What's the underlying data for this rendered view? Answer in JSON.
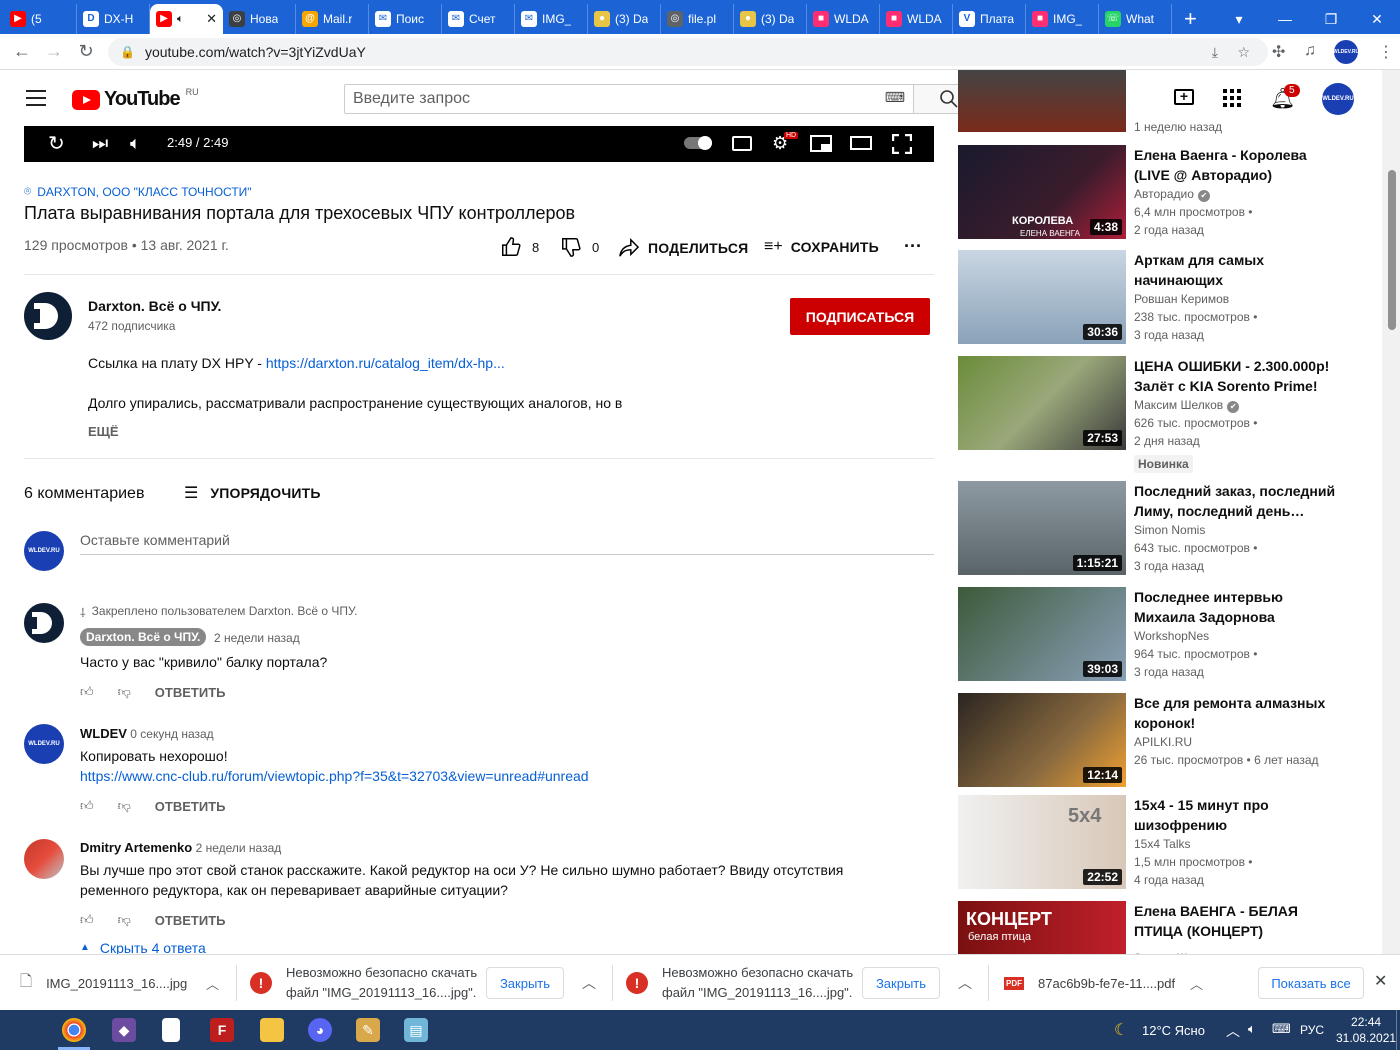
{
  "browser": {
    "tabs": [
      {
        "label": "(5",
        "color": "#ff0000",
        "letter": "▶"
      },
      {
        "label": "DX-H",
        "color": "#ffffff",
        "letter": "D"
      },
      {
        "label": "",
        "color": "#ff0000",
        "letter": "▶",
        "active": true
      },
      {
        "label": "Нова",
        "color": "#3c4043",
        "letter": "◎"
      },
      {
        "label": "Mail.r",
        "color": "#f7a600",
        "letter": "@"
      },
      {
        "label": "Поис",
        "color": "#ffffff",
        "letter": "✉"
      },
      {
        "label": "Счет",
        "color": "#ffffff",
        "letter": "✉"
      },
      {
        "label": "IMG_",
        "color": "#ffffff",
        "letter": "✉"
      },
      {
        "label": "(3) Da",
        "color": "#e8c547",
        "letter": "●"
      },
      {
        "label": "file.pl",
        "color": "#5f6368",
        "letter": "◎"
      },
      {
        "label": "(3) Da",
        "color": "#e8c547",
        "letter": "●"
      },
      {
        "label": "WLDA",
        "color": "#ff2d72",
        "letter": "■"
      },
      {
        "label": "WLDA",
        "color": "#ff2d72",
        "letter": "■"
      },
      {
        "label": "Плата",
        "color": "#ffffff",
        "letter": "V"
      },
      {
        "label": "IMG_",
        "color": "#ff2d72",
        "letter": "■"
      },
      {
        "label": "What",
        "color": "#25d366",
        "letter": "☏"
      }
    ],
    "url": "youtube.com/watch?v=3jtYiZvdUaY"
  },
  "header": {
    "logo_word": "YouTube",
    "logo_region": "RU",
    "search_placeholder": "Введите запрос",
    "notifications": "5",
    "user_avatar": "WLDEV.RU"
  },
  "player": {
    "time": "2:49 / 2:49"
  },
  "video": {
    "hashtag": "DARXTON, ООО \"КЛАСС ТОЧНОСТИ\"",
    "title": "Плата выравнивания портала для трехосевых ЧПУ контроллеров",
    "stats": "129 просмотров • 13 авг. 2021 г.",
    "likes": "8",
    "dislikes": "0",
    "share": "ПОДЕЛИТЬСЯ",
    "save": "СОХРАНИТЬ"
  },
  "channel": {
    "name": "Darxton. Всё о ЧПУ.",
    "subs": "472 подписчика",
    "subscribe": "ПОДПИСАТЬСЯ",
    "desc_prefix": "Ссылка на плату DX HPY - ",
    "desc_link": "https://darxton.ru/catalog_item/dx-hp...",
    "desc_line2": "Долго упирались, рассматривали распространение существующих аналогов, но в",
    "more": "ЕЩЁ"
  },
  "comments": {
    "count": "6 комментариев",
    "sort": "УПОРЯДОЧИТЬ",
    "placeholder": "Оставьте комментарий",
    "my_avatar": "WLDEV.RU",
    "reply": "ОТВЕТИТЬ",
    "items": [
      {
        "pinned": "Закреплено пользователем Darxton. Всё о ЧПУ.",
        "author": "Darxton. Всё о ЧПУ.",
        "time": "2 недели назад",
        "text": "Часто у вас \"кривило\" балку портала?"
      },
      {
        "author": "WLDEV",
        "time": "0 секунд назад",
        "text": "Копировать нехорошо!",
        "link": "https://www.cnc-club.ru/forum/viewtopic.php?f=35&t=32703&view=unread#unread"
      },
      {
        "author": "Dmitry Artemenko",
        "time": "2 недели назад",
        "text1": "Вы лучше про этот свой станок расскажите. Какой редуктор на оси У? Не сильно шумно работает? Ввиду отсутствия",
        "text2": "ременного редуктора, как он переваривает аварийные ситуации?",
        "replies": "Скрыть 4 ответа"
      }
    ]
  },
  "sidebar": {
    "top_partial": "1 неделю назад",
    "videos": [
      {
        "title1": "Елена Ваенга - Королева",
        "title2": "(LIVE @ Авторадио)",
        "channel": "Авторадио",
        "views": "6,4 млн просмотров •",
        "age": "2 года назад",
        "duration": "4:38",
        "thumb_text": "КОРОЛЕВА",
        "thumb_sub": "ЕЛЕНА ВАЕНГА"
      },
      {
        "title1": "Арткам для самых",
        "title2": "начинающих",
        "channel": "Ровшан Керимов",
        "views": "238 тыс. просмотров •",
        "age": "3 года назад",
        "duration": "30:36"
      },
      {
        "title1": "ЦЕНА ОШИБКИ - 2.300.000р!",
        "title2": "Залёт с KIA Sorento Prime!",
        "channel": "Максим Шелков",
        "views": "626 тыс. просмотров •",
        "age": "2 дня назад",
        "duration": "27:53",
        "badge": "Новинка"
      },
      {
        "title1": "Последний заказ, последний",
        "title2": "Лиму, последний день…",
        "channel": "Simon Nomis",
        "views": "643 тыс. просмотров •",
        "age": "3 года назад",
        "duration": "1:15:21"
      },
      {
        "title1": "Последнее интервью",
        "title2": "Михаила Задорнова",
        "channel": "WorkshopNes",
        "views": "964 тыс. просмотров •",
        "age": "3 года назад",
        "duration": "39:03"
      },
      {
        "title1": "Все для ремонта алмазных",
        "title2": "коронок!",
        "channel": "APILKI.RU",
        "views": "26 тыс. просмотров • 6 лет назад",
        "age": "",
        "duration": "12:14"
      },
      {
        "title1": "15x4 - 15 минут про",
        "title2": "шизофрению",
        "channel": "15x4 Talks",
        "views": "1,5 млн просмотров •",
        "age": "4 года назад",
        "duration": "22:52",
        "thumb_text": "5x4"
      },
      {
        "title1": "Елена ВАЕНГА - БЕЛАЯ",
        "title2": "ПТИЦА (КОНЦЕРТ)",
        "channel": "Золото Шансона",
        "views": "",
        "age": "",
        "duration": "",
        "thumb_text": "КОНЦЕРТ",
        "thumb_sub": "белая птица"
      }
    ]
  },
  "downloads": {
    "file1": "IMG_20191113_16....jpg",
    "warn1a": "Невозможно безопасно скачать",
    "warn1b": "файл \"IMG_20191113_16....jpg\".",
    "close": "Закрыть",
    "warn2a": "Невозможно безопасно скачать",
    "warn2b": "файл \"IMG_20191113_16....jpg\".",
    "file4": "87ac6b9b-fe7e-11....pdf",
    "pdf_label": "PDF",
    "show_all": "Показать все"
  },
  "taskbar": {
    "weather": "12°C Ясно",
    "lang": "РУС",
    "time": "22:44",
    "date": "31.08.2021"
  }
}
